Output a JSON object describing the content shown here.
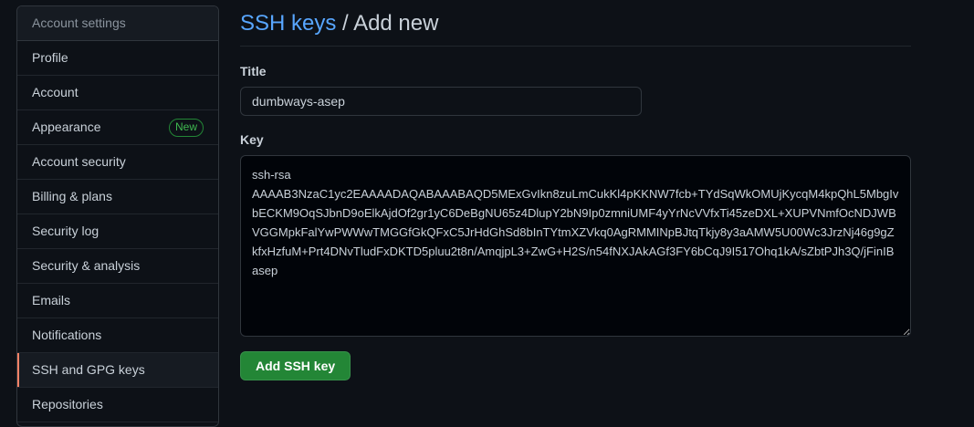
{
  "sidebar": {
    "header": "Account settings",
    "items": [
      {
        "label": "Profile"
      },
      {
        "label": "Account"
      },
      {
        "label": "Appearance",
        "badge": "New"
      },
      {
        "label": "Account security"
      },
      {
        "label": "Billing & plans"
      },
      {
        "label": "Security log"
      },
      {
        "label": "Security & analysis"
      },
      {
        "label": "Emails"
      },
      {
        "label": "Notifications"
      },
      {
        "label": "SSH and GPG keys",
        "selected": true
      },
      {
        "label": "Repositories"
      }
    ]
  },
  "main": {
    "breadcrumb": {
      "link": "SSH keys",
      "separator": " / ",
      "current": "Add new"
    },
    "title_field": {
      "label": "Title",
      "value": "dumbways-asep"
    },
    "key_field": {
      "label": "Key",
      "value": "ssh-rsa\nAAAAB3NzaC1yc2EAAAADAQABAAABAQD5MExGvIkn8zuLmCukKl4pKKNW7fcb+TYdSqWkOMUjKycqM4kpQhL5MbgIvbECKM9OqSJbnD9oElkAjdOf2gr1yC6DeBgNU65z4DlupY2bN9Ip0zmniUMF4yYrNcVVfxTi45zeDXL+XUPVNmfOcNDJWBVGGMpkFalYwPWWwTMGGfGkQFxC5JrHdGhSd8bInTYtmXZVkq0AgRMMINpBJtqTkjy8y3aAMW5U00Wc3JrzNj46g9gZkfxHzfuM+Prt4DNvTludFxDKTD5pluu2t8n/AmqjpL3+ZwG+H2S/n54fNXJAkAGf3FY6bCqJ9I517Ohq1kA/sZbtPJh3Q/jFinIB asep"
    },
    "submit_label": "Add SSH key"
  },
  "colors": {
    "background": "#0d1117",
    "link": "#58a6ff",
    "primary_button": "#238636",
    "selected_indicator": "#f78166",
    "badge": "#3fb950"
  }
}
